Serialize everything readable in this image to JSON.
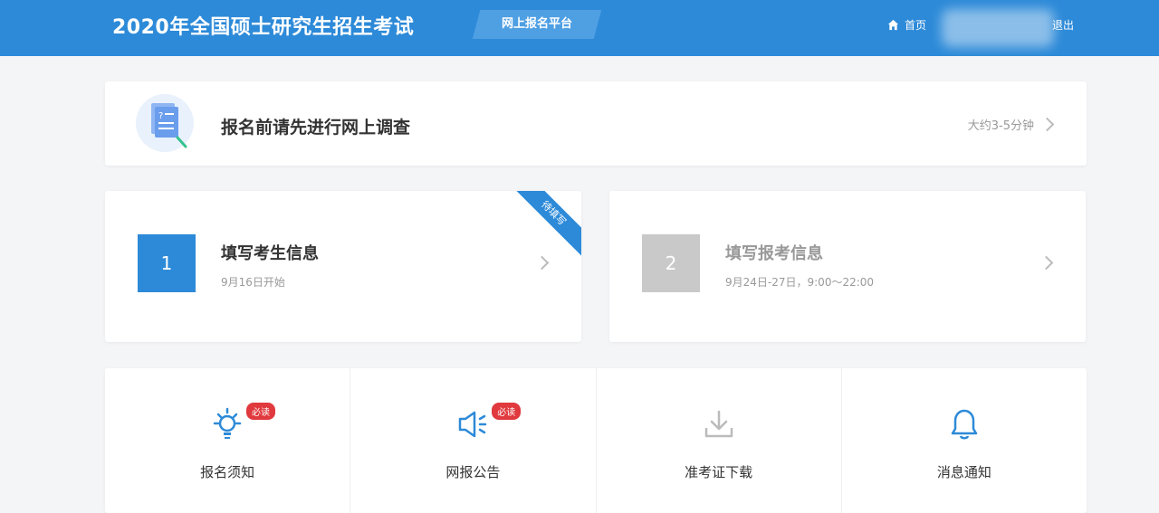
{
  "header": {
    "title": "2020年全国硕士研究生招生考试",
    "platform": "网上报名平台",
    "home": "首页",
    "logout": "退出"
  },
  "survey": {
    "label": "报名前请先进行网上调查",
    "hint": "大约3-5分钟"
  },
  "steps": [
    {
      "number": "1",
      "title": "填写考生信息",
      "date": "9月16日开始",
      "ribbon": "待填写"
    },
    {
      "number": "2",
      "title": "填写报考信息",
      "date": "9月24日-27日，9:00～22:00"
    }
  ],
  "quick": [
    {
      "label": "报名须知",
      "badge": "必读",
      "icon": "lightbulb-icon"
    },
    {
      "label": "网报公告",
      "badge": "必读",
      "icon": "megaphone-icon"
    },
    {
      "label": "准考证下载",
      "icon": "download-icon"
    },
    {
      "label": "消息通知",
      "icon": "bell-icon"
    }
  ],
  "colors": {
    "primary": "#2d8ad8",
    "badge": "#e0393e",
    "disabled": "#c9c9c9"
  }
}
